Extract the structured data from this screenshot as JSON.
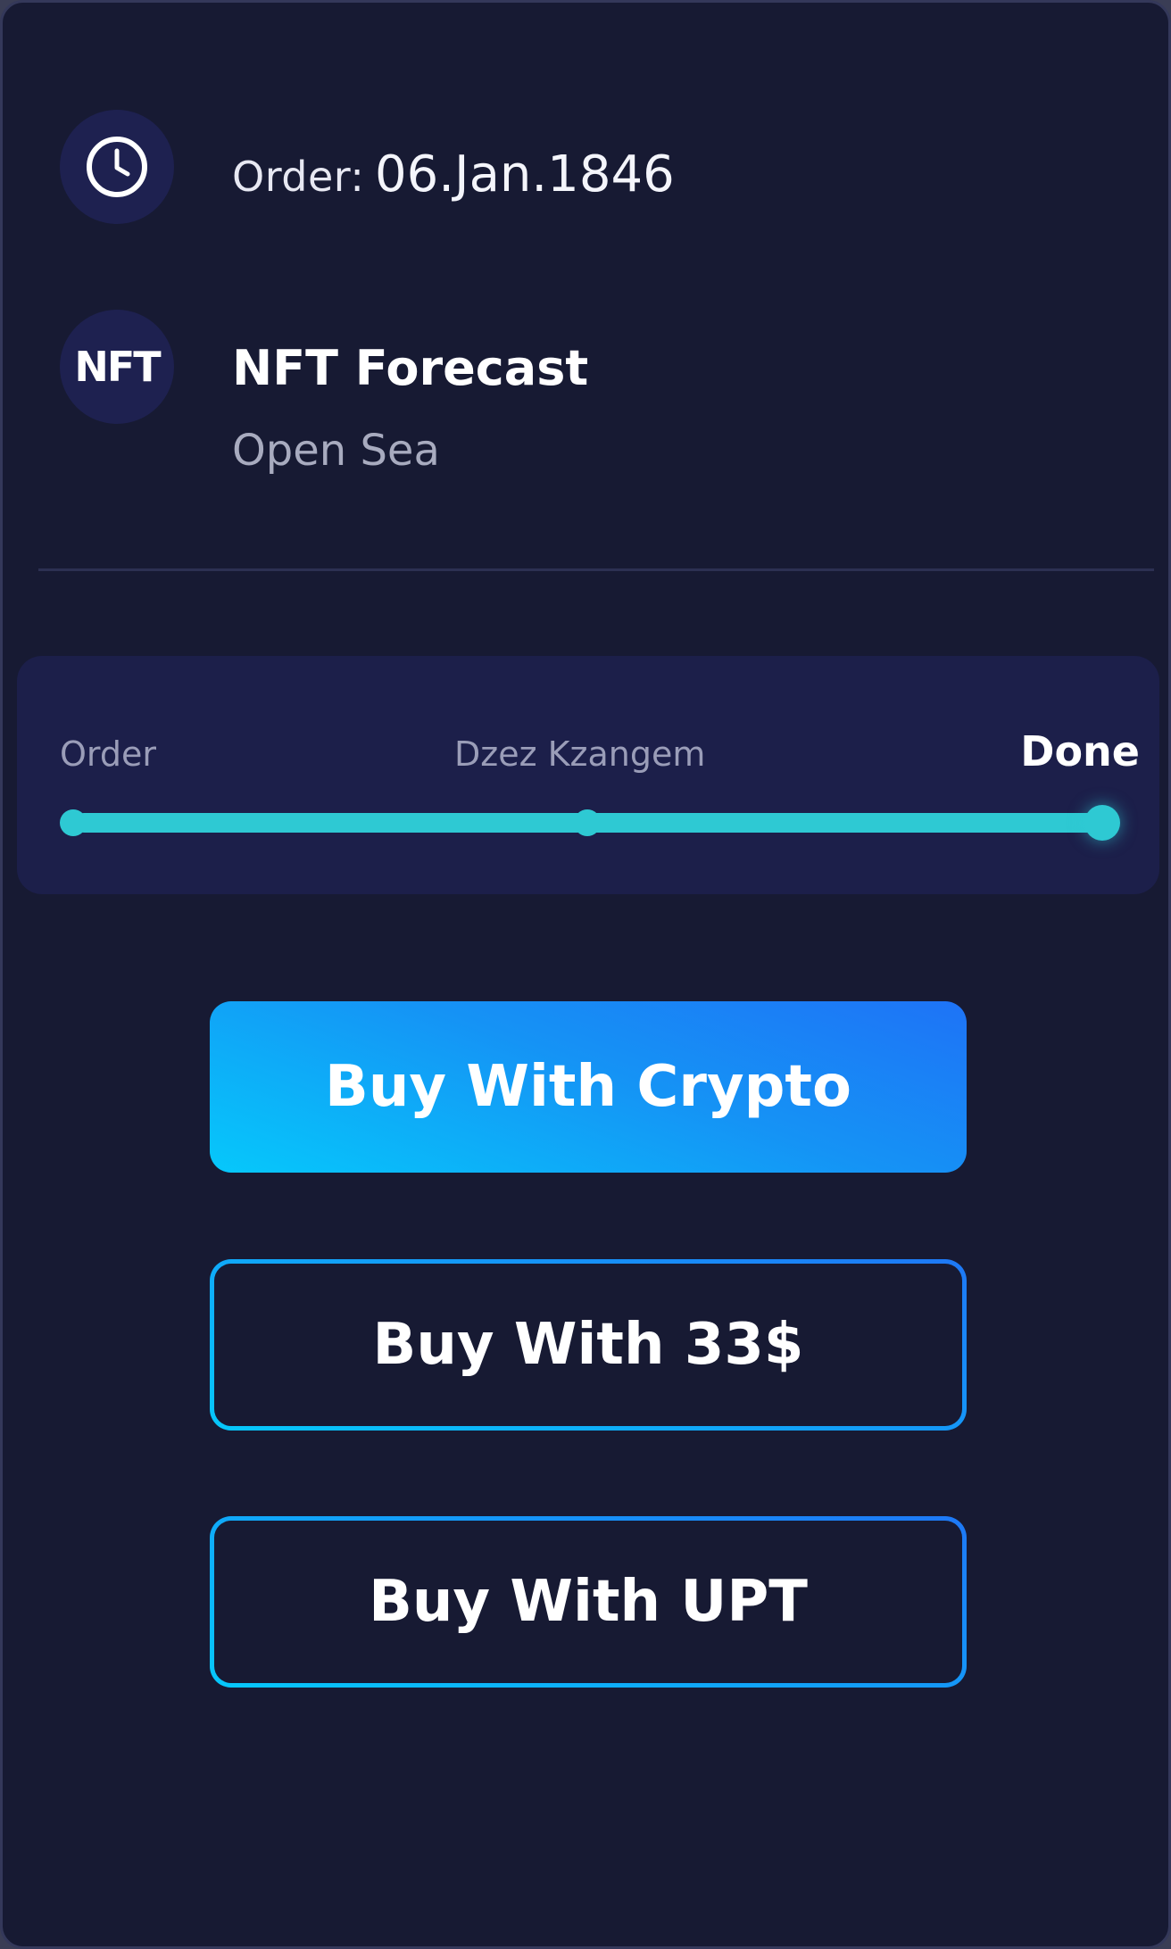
{
  "order": {
    "label": "Order:",
    "date": "06.Jan.1846"
  },
  "nft": {
    "logo_text": "NFT",
    "title": "NFT Forecast",
    "marketplace": "Open Sea"
  },
  "progress": {
    "steps": [
      "Order",
      "Dzez Kzangem",
      "Done"
    ],
    "current_step": "Done",
    "fraction_complete": 1.0,
    "color": "#2ec9d3"
  },
  "buttons": {
    "crypto": "Buy With Crypto",
    "usd": "Buy With 33$",
    "upt": "Buy With UPT"
  },
  "colors": {
    "background": "#171a33",
    "panel": "#1c1f4a",
    "accent_start": "#06c8fb",
    "accent_end": "#1e73f6"
  },
  "icons": {
    "order": "clock-icon",
    "nft": "nft-logo-icon"
  }
}
